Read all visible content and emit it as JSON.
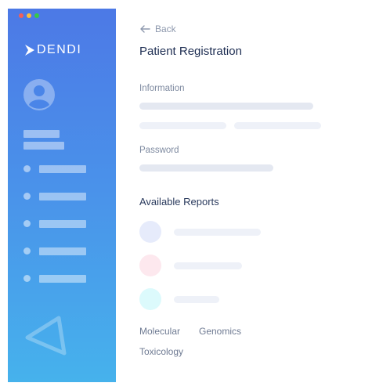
{
  "window": {
    "controls": [
      {
        "name": "close",
        "color": "#f25f58"
      },
      {
        "name": "minimize",
        "color": "#fbbe3c"
      },
      {
        "name": "maximize",
        "color": "#37c84a"
      }
    ]
  },
  "sidebar": {
    "logo_text": "DENDI",
    "avatar_icon": "user-avatar-icon",
    "nav_items": [
      "item-1",
      "item-2",
      "item-3",
      "item-4",
      "item-5"
    ]
  },
  "header": {
    "back_label": "Back",
    "title": "Patient Registration"
  },
  "form": {
    "information_label": "Information",
    "password_label": "Password"
  },
  "reports": {
    "heading": "Available Reports",
    "items": [
      {
        "color": "#e6ebfb"
      },
      {
        "color": "#fde8ee"
      },
      {
        "color": "#dcfafc"
      }
    ],
    "tags": [
      "Molecular",
      "Genomics",
      "Toxicology"
    ]
  },
  "colors": {
    "accent": "#4c79e6",
    "title": "#1d2d52",
    "muted": "#7e8aa0"
  }
}
